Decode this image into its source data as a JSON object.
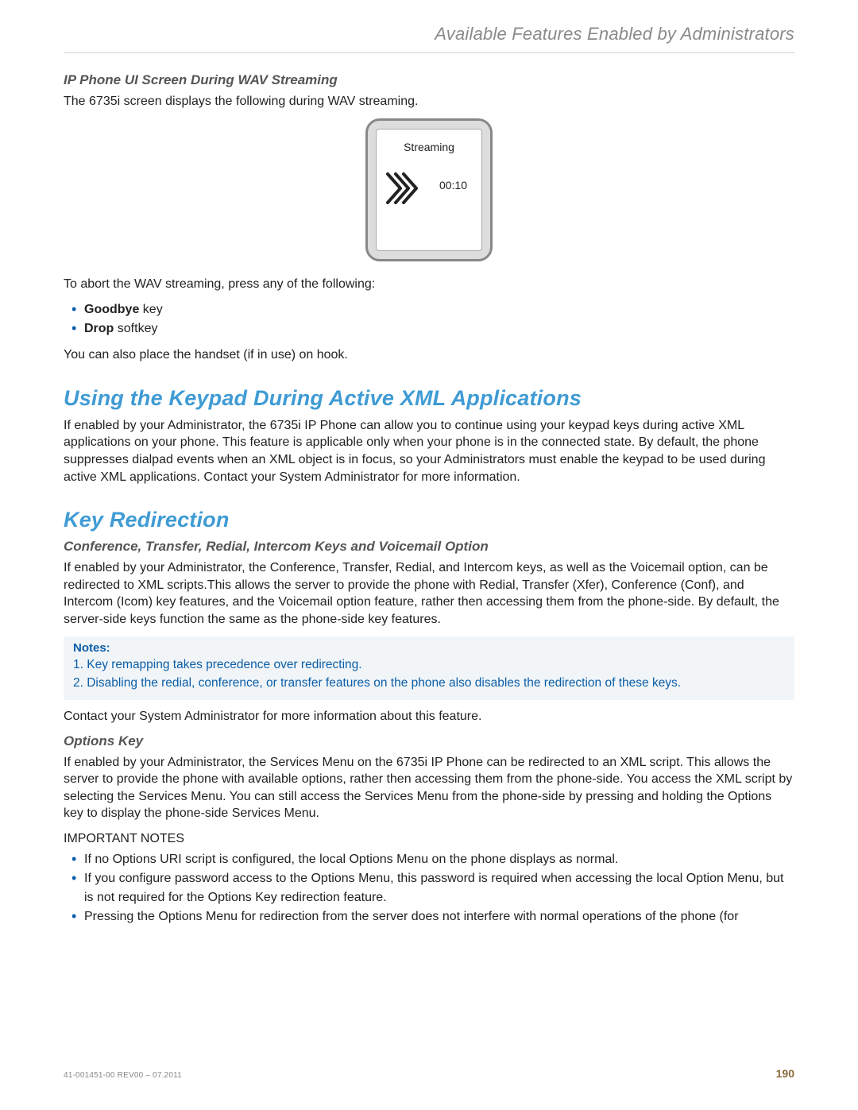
{
  "header": {
    "running": "Available Features Enabled by Administrators"
  },
  "sec1": {
    "title": "IP Phone UI Screen During WAV Streaming",
    "intro": "The 6735i screen displays the following during WAV streaming.",
    "phone": {
      "streaming": "Streaming",
      "time": "00:10"
    },
    "abort": "To abort the WAV streaming, press any of the following:",
    "goodbye_bold": "Goodbye",
    "goodbye_rest": " key",
    "drop_bold": "Drop",
    "drop_rest": " softkey",
    "handset": "You can also place the handset (if in use) on hook."
  },
  "sec2": {
    "title": "Using the Keypad During Active XML Applications",
    "para": "If enabled by your Administrator, the 6735i IP Phone can allow you to continue using your keypad keys during active XML applications on your phone. This feature is applicable only when your phone is in the connected state. By default, the phone suppresses dialpad events when an XML object is in focus, so your Administrators must enable the keypad to be used during active XML applications. Contact your System Administrator for more information."
  },
  "sec3": {
    "title": "Key Redirection",
    "sub1": "Conference, Transfer, Redial, Intercom Keys and Voicemail Option",
    "para1": "If enabled by your Administrator, the Conference, Transfer, Redial, and Intercom keys, as well as the Voicemail option, can be redirected to XML scripts.This allows the server to provide the phone with Redial, Transfer (Xfer), Conference (Conf), and Intercom (Icom) key features, and the Voicemail option feature, rather then accessing them from the phone-side. By default, the server-side keys function the same as the phone-side key features.",
    "notes_label": "Notes:",
    "note1": "1. Key remapping takes precedence over redirecting.",
    "note2": "2. Disabling the redial, conference, or transfer features on the phone also disables the redirection of these keys.",
    "contact": "Contact your System Administrator for more information about this feature.",
    "sub2": "Options Key",
    "para2": "If enabled by your Administrator, the Services Menu on the 6735i IP Phone can be redirected to an XML script. This allows the server to provide the phone with available options, rather then accessing them from the phone-side. You access the XML script by selecting the Services Menu. You can still access the Services Menu from the phone-side by pressing and holding the Options key to display the phone-side Services Menu.",
    "important": "IMPORTANT NOTES",
    "b1": "If no Options URI script is configured, the local Options Menu on the phone displays as normal.",
    "b2": "If you configure password access to the Options Menu, this password is required when accessing the local Option Menu, but is not required for the Options Key redirection feature.",
    "b3": "Pressing the Options Menu for redirection from the server does not interfere with normal operations of the phone (for"
  },
  "footer": {
    "left": "41-001451-00 REV00 – 07.2011",
    "page": "190"
  }
}
